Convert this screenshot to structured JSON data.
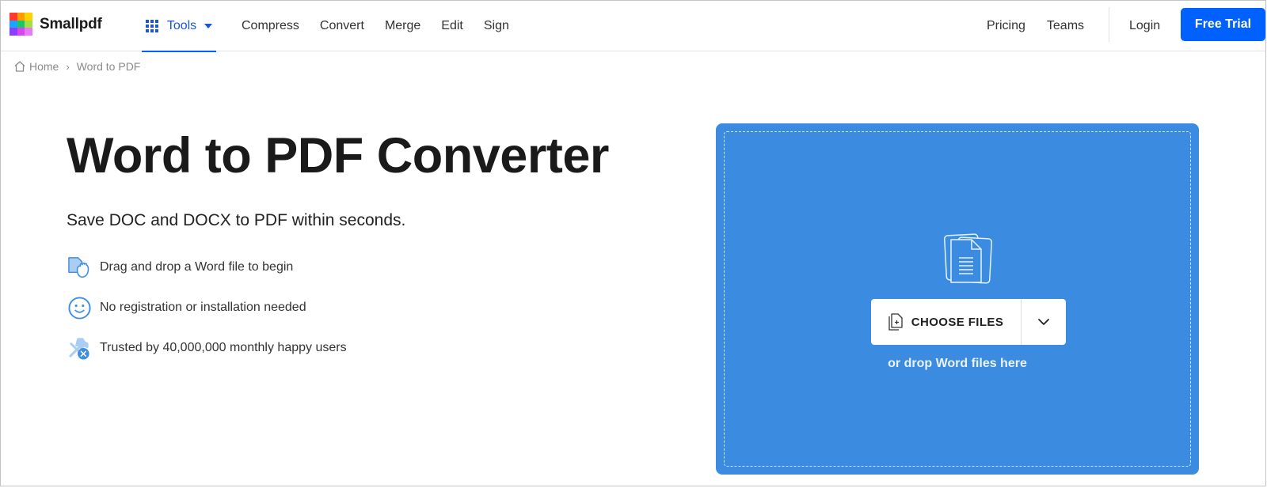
{
  "header": {
    "brand": "Smallpdf",
    "logo_colors": [
      "#ff3b2f",
      "#ff9a00",
      "#ffd200",
      "#1aa3ff",
      "#17c964",
      "#a4e044",
      "#8a3ffc",
      "#d946ef",
      "#e879f9"
    ],
    "tools_label": "Tools",
    "nav": [
      "Compress",
      "Convert",
      "Merge",
      "Edit",
      "Sign"
    ],
    "right_nav": [
      "Pricing",
      "Teams"
    ],
    "login_label": "Login",
    "cta_label": "Free Trial",
    "accent_color": "#0061fe"
  },
  "breadcrumb": {
    "home": "Home",
    "separator": "›",
    "current": "Word to PDF"
  },
  "hero": {
    "title": "Word to PDF Converter",
    "subtitle": "Save DOC and DOCX to PDF within seconds.",
    "features": [
      {
        "icon": "drag-drop-icon",
        "text": "Drag and drop a Word file to begin"
      },
      {
        "icon": "smiley-icon",
        "text": "No registration or installation needed"
      },
      {
        "icon": "tools-badge-icon",
        "text": "Trusted by 40,000,000 monthly happy users"
      }
    ]
  },
  "dropzone": {
    "background_color": "#3b8ce0",
    "choose_label": "CHOOSE FILES",
    "hint": "or drop Word files here"
  }
}
